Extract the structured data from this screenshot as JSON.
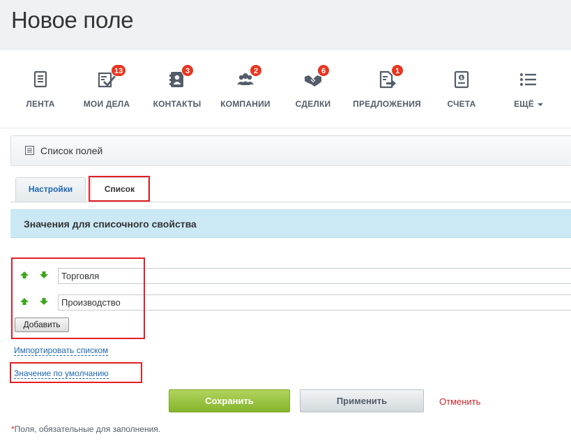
{
  "page": {
    "title": "Новое поле"
  },
  "nav": {
    "items": [
      {
        "label": "ЛЕНТА",
        "badge": "",
        "icon": "feed-icon"
      },
      {
        "label": "МОИ ДЕЛА",
        "badge": "13",
        "icon": "tasks-icon"
      },
      {
        "label": "КОНТАКТЫ",
        "badge": "3",
        "icon": "contacts-icon"
      },
      {
        "label": "КОМПАНИИ",
        "badge": "2",
        "icon": "companies-icon"
      },
      {
        "label": "СДЕЛКИ",
        "badge": "6",
        "icon": "deals-icon"
      },
      {
        "label": "ПРЕДЛОЖЕНИЯ",
        "badge": "1",
        "icon": "quotes-icon"
      },
      {
        "label": "СЧЕТА",
        "badge": "",
        "icon": "invoices-icon"
      },
      {
        "label": "ЕЩЁ",
        "badge": "",
        "icon": "more-icon"
      }
    ]
  },
  "fields_bar": {
    "label": "Список полей",
    "icon": "list-icon"
  },
  "tabs": [
    {
      "label": "Настройки"
    },
    {
      "label": "Список"
    }
  ],
  "section": {
    "title": "Значения для списочного свойства"
  },
  "values": [
    {
      "value": "Торговля"
    },
    {
      "value": "Производство"
    }
  ],
  "buttons": {
    "add": "Добавить",
    "save": "Сохранить",
    "apply": "Применить",
    "cancel": "Отменить"
  },
  "links": {
    "import": "Импортировать списком",
    "default_value": "Значение по умолчанию"
  },
  "footer": {
    "required_star": "*",
    "required_note": "Поля, обязательные для заполнения."
  },
  "colors": {
    "accent": "#2067b0",
    "badge": "#e8351f",
    "save": "#84b52c",
    "cancel": "#d2232a",
    "highlight": "#e31e24"
  }
}
